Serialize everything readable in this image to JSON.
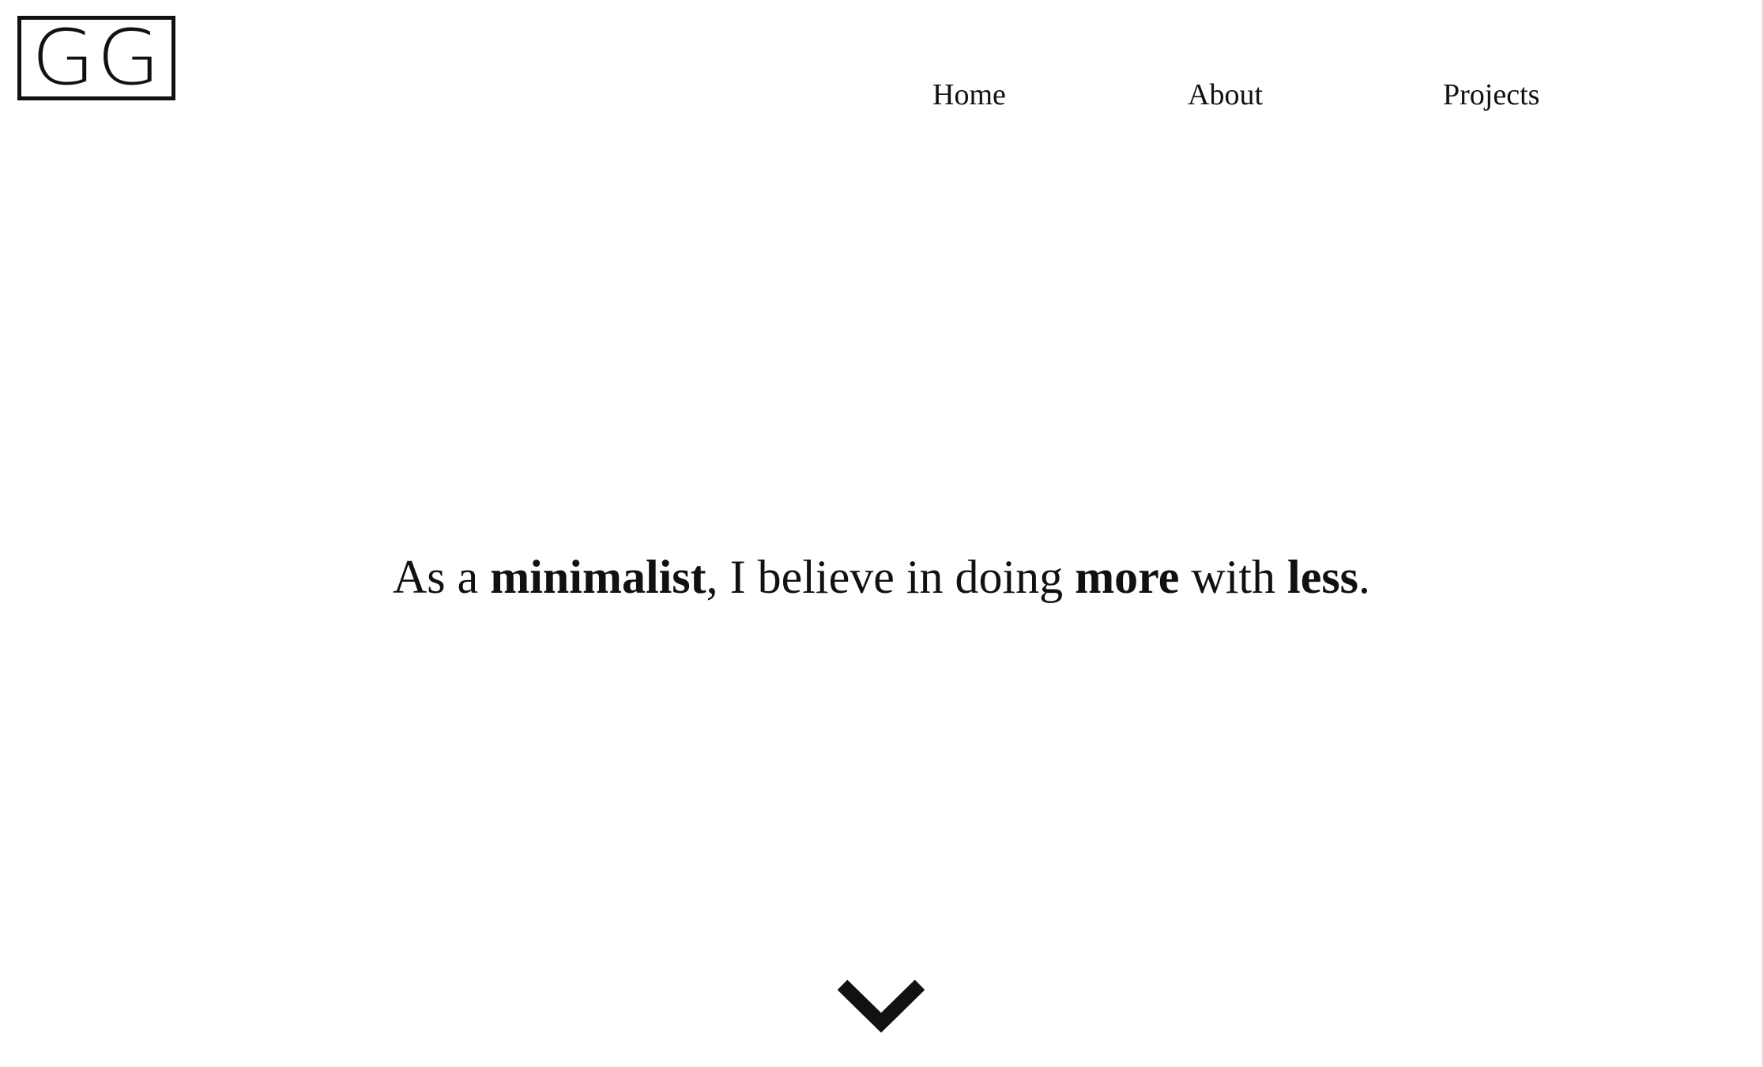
{
  "logo": {
    "text": "GG"
  },
  "nav": {
    "items": [
      {
        "label": "Home"
      },
      {
        "label": "About"
      },
      {
        "label": "Projects"
      }
    ]
  },
  "hero": {
    "part1": "As a ",
    "bold1": "minimalist",
    "part2": ", I believe in doing ",
    "bold2": "more",
    "part3": " with ",
    "bold3": "less",
    "part4": "."
  },
  "scroll": {
    "icon": "chevron-down-icon"
  },
  "colors": {
    "text": "#111111",
    "background": "#ffffff"
  }
}
